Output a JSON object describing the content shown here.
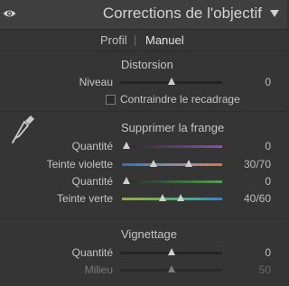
{
  "header": {
    "title": "Corrections de l'objectif"
  },
  "tabs": [
    {
      "label": "Profil"
    },
    {
      "label": "Manuel"
    }
  ],
  "distortion": {
    "title": "Distorsion",
    "niveau": {
      "label": "Niveau",
      "value": "0",
      "level": 0
    },
    "constrain_crop": {
      "label": "Contraindre le recadrage",
      "checked": false
    }
  },
  "fringe": {
    "title": "Supprimer la frange",
    "purple_amount": {
      "label": "Quantité",
      "value": "0",
      "level": 0
    },
    "purple_hue": {
      "label": "Teinte violette",
      "value": "30/70",
      "low": 30,
      "high": 70
    },
    "green_amount": {
      "label": "Quantité",
      "value": "0",
      "level": 0
    },
    "green_hue": {
      "label": "Teinte verte",
      "value": "40/60",
      "low": 40,
      "high": 60
    }
  },
  "vignetting": {
    "title": "Vignettage",
    "amount": {
      "label": "Quantité",
      "value": "0",
      "level": 0
    },
    "midpoint": {
      "label": "Milieu",
      "value": "50",
      "level": 50
    }
  },
  "colors": {
    "accent_purple": "#8a4fb3",
    "accent_green": "#4f9f4f"
  }
}
